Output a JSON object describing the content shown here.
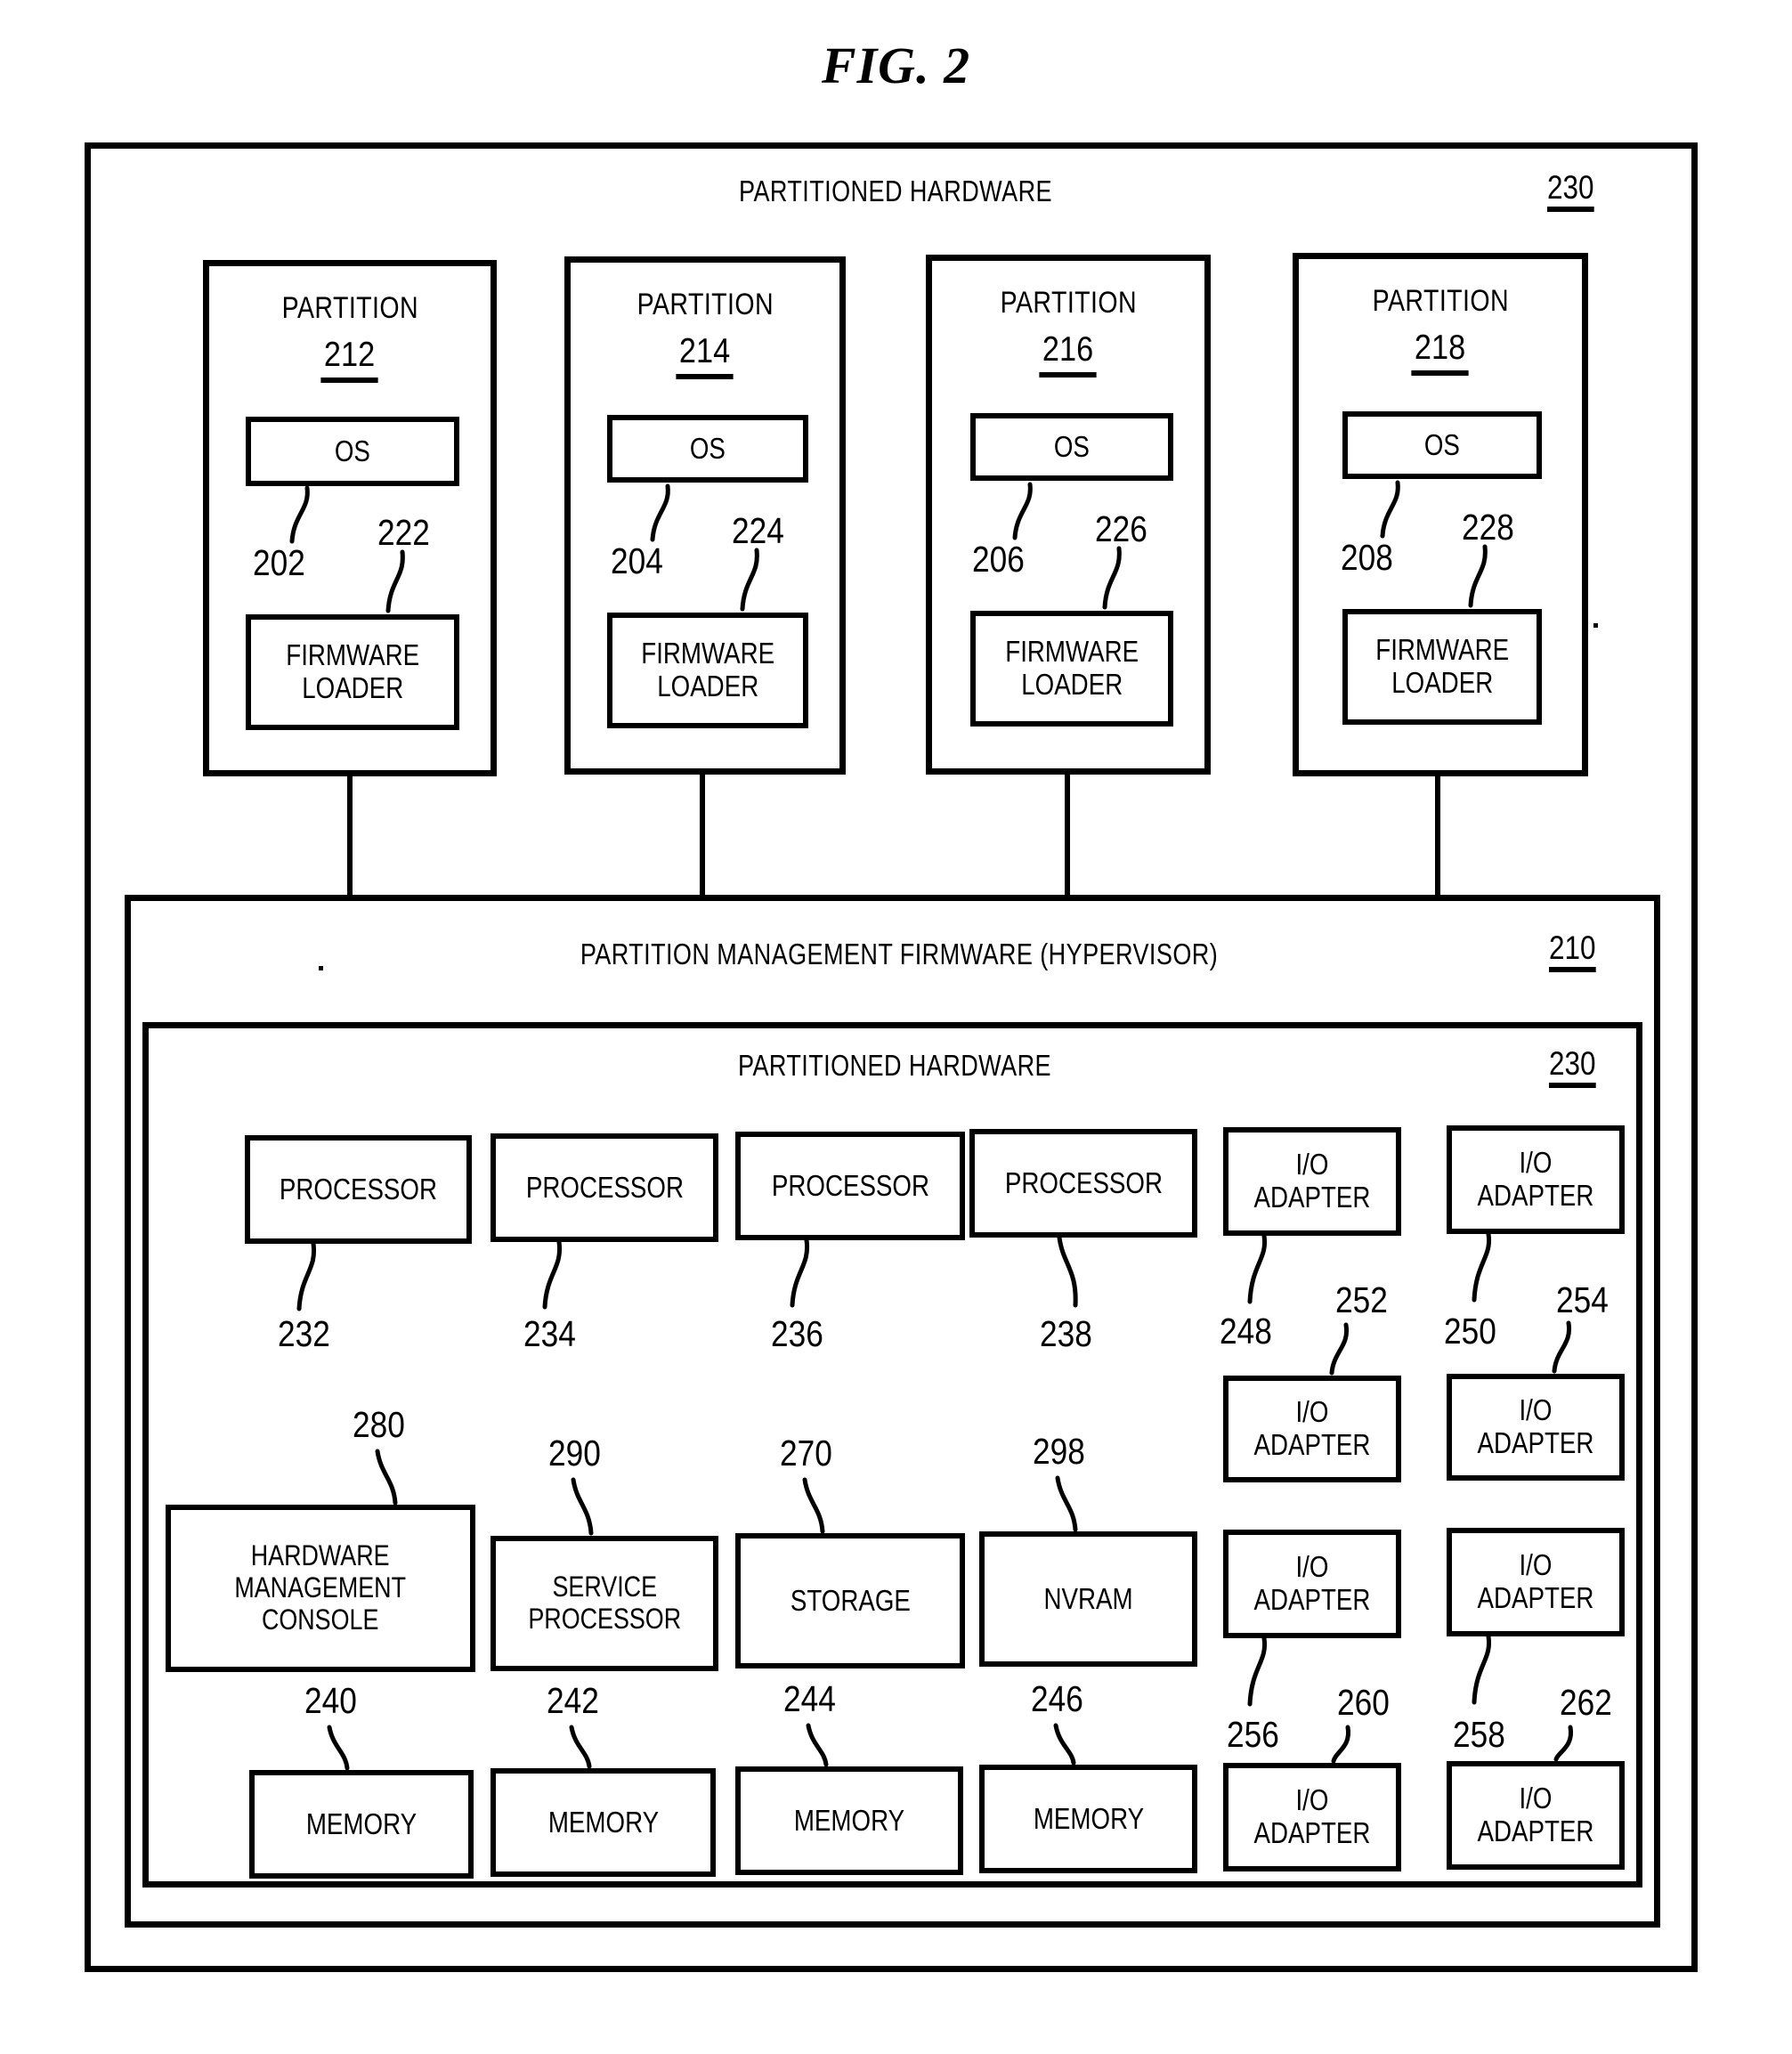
{
  "figure": {
    "title": "FIG. 2"
  },
  "outer": {
    "heading": "PARTITIONED HARDWARE",
    "ref": "230"
  },
  "partitions": [
    {
      "title": "PARTITION",
      "ref": "212",
      "os_label": "OS",
      "os_ref": "202",
      "firmware_label": "FIRMWARE\nLOADER",
      "firmware_ref": "222"
    },
    {
      "title": "PARTITION",
      "ref": "214",
      "os_label": "OS",
      "os_ref": "204",
      "firmware_label": "FIRMWARE\nLOADER",
      "firmware_ref": "224"
    },
    {
      "title": "PARTITION",
      "ref": "216",
      "os_label": "OS",
      "os_ref": "206",
      "firmware_label": "FIRMWARE\nLOADER",
      "firmware_ref": "226"
    },
    {
      "title": "PARTITION",
      "ref": "218",
      "os_label": "OS",
      "os_ref": "208",
      "firmware_label": "FIRMWARE\nLOADER",
      "firmware_ref": "228"
    }
  ],
  "hypervisor": {
    "heading": "PARTITION MANAGEMENT FIRMWARE (HYPERVISOR)",
    "ref": "210"
  },
  "hardware": {
    "heading": "PARTITIONED HARDWARE",
    "ref": "230",
    "processors": [
      {
        "label": "PROCESSOR",
        "ref": "232"
      },
      {
        "label": "PROCESSOR",
        "ref": "234"
      },
      {
        "label": "PROCESSOR",
        "ref": "236"
      },
      {
        "label": "PROCESSOR",
        "ref": "238"
      }
    ],
    "services": [
      {
        "label": "HARDWARE\nMANAGEMENT\nCONSOLE",
        "ref": "280"
      },
      {
        "label": "SERVICE\nPROCESSOR",
        "ref": "290"
      },
      {
        "label": "STORAGE",
        "ref": "270"
      },
      {
        "label": "NVRAM",
        "ref": "298"
      }
    ],
    "memories": [
      {
        "label": "MEMORY",
        "ref": "240"
      },
      {
        "label": "MEMORY",
        "ref": "242"
      },
      {
        "label": "MEMORY",
        "ref": "244"
      },
      {
        "label": "MEMORY",
        "ref": "246"
      }
    ],
    "io_adapters": [
      {
        "label": "I/O\nADAPTER",
        "ref": "248"
      },
      {
        "label": "I/O\nADAPTER",
        "ref": "250"
      },
      {
        "label": "I/O\nADAPTER",
        "ref": "252"
      },
      {
        "label": "I/O\nADAPTER",
        "ref": "254"
      },
      {
        "label": "I/O\nADAPTER",
        "ref": "256"
      },
      {
        "label": "I/O\nADAPTER",
        "ref": "258"
      },
      {
        "label": "I/O\nADAPTER",
        "ref": "260"
      },
      {
        "label": "I/O\nADAPTER",
        "ref": "262"
      }
    ]
  }
}
